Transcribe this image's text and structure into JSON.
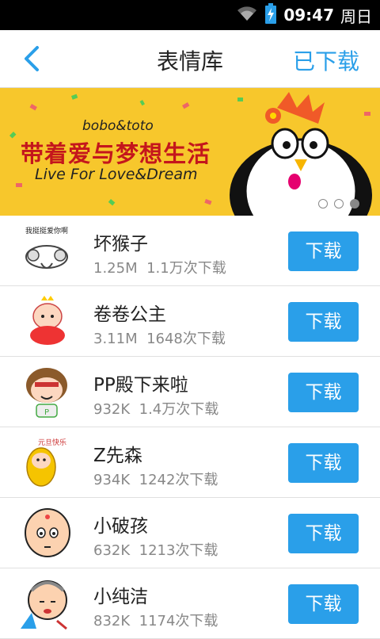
{
  "status_bar": {
    "time": "09:47",
    "day": "周日"
  },
  "header": {
    "title": "表情库",
    "downloaded_label": "已下载"
  },
  "banner": {
    "brand": "bobo&toto",
    "slogan": "带着爱与梦想生活",
    "english": "Live For Love&Dream",
    "page_count": 3,
    "active_page": 3
  },
  "packs": [
    {
      "name": "坏猴子",
      "size": "1.25M",
      "downloads": "1.1万次下载",
      "button": "下载",
      "thumb_caption": "我挺挺爱你啊"
    },
    {
      "name": "卷卷公主",
      "size": "3.11M",
      "downloads": "1648次下载",
      "button": "下载"
    },
    {
      "name": "PP殿下来啦",
      "size": "932K",
      "downloads": "1.4万次下载",
      "button": "下载"
    },
    {
      "name": "Z先森",
      "size": "934K",
      "downloads": "1242次下载",
      "button": "下载",
      "thumb_caption": "元旦快乐"
    },
    {
      "name": "小破孩",
      "size": "632K",
      "downloads": "1213次下载",
      "button": "下载"
    },
    {
      "name": "小纯洁",
      "size": "832K",
      "downloads": "1174次下载",
      "button": "下载"
    }
  ],
  "colors": {
    "accent": "#2a9fe9",
    "banner_bg": "#f7c72c",
    "slogan": "#c4161c"
  }
}
